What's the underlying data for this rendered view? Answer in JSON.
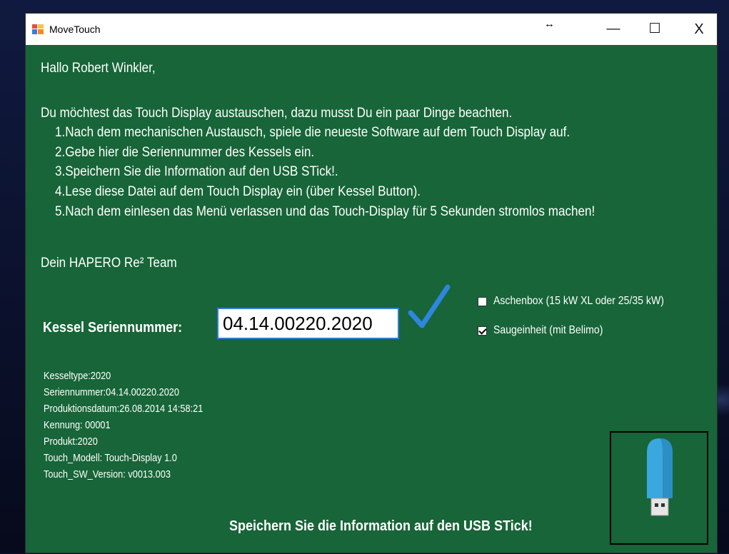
{
  "window": {
    "title": "MoveTouch",
    "resize_glyph": "↔",
    "controls": {
      "minimize": "—",
      "maximize": "☐",
      "close": "X"
    }
  },
  "content": {
    "greeting": "Hallo Robert Winkler,",
    "intro": "Du möchtest das Touch Display austauschen, dazu musst Du ein paar Dinge beachten.",
    "steps": [
      "1.Nach dem mechanischen Austausch, spiele die neueste Software auf dem Touch Display auf.",
      "2.Gebe hier die Seriennummer des Kessels ein.",
      "3.Speichern Sie die Information auf den USB STick!.",
      "4.Lese diese Datei auf dem Touch Display ein (über Kessel Button).",
      "5.Nach dem einlesen das Menü verlassen und das Touch-Display für 5 Sekunden stromlos machen!"
    ],
    "signature": "Dein HAPERO Re² Team"
  },
  "serial": {
    "label": "Kessel Seriennummer:",
    "value": "04.14.00220.2020"
  },
  "options": {
    "ash_box": {
      "label": "Aschenbox (15 kW XL oder 25/35 kW)",
      "checked": false
    },
    "suction_unit": {
      "label": "Saugeinheit (mit Belimo)",
      "checked": true
    }
  },
  "info_lines": [
    "Kesseltype:2020",
    "Seriennummer:04.14.00220.2020",
    "Produktionsdatum:26.08.2014 14:58:21",
    "Kennung: 00001",
    "Produkt:2020",
    "Touch_Modell: Touch-Display 1.0",
    "Touch_SW_Version: v0013.003"
  ],
  "save_label": "Speichern Sie die Information auf den USB STick!",
  "icons": {
    "app": "app-icon",
    "check": "checkmark-icon",
    "usb": "usb-stick-icon"
  },
  "colors": {
    "window_background": "#176538",
    "checkmark": "#2e86de",
    "usb_body": "#3aa7df"
  }
}
